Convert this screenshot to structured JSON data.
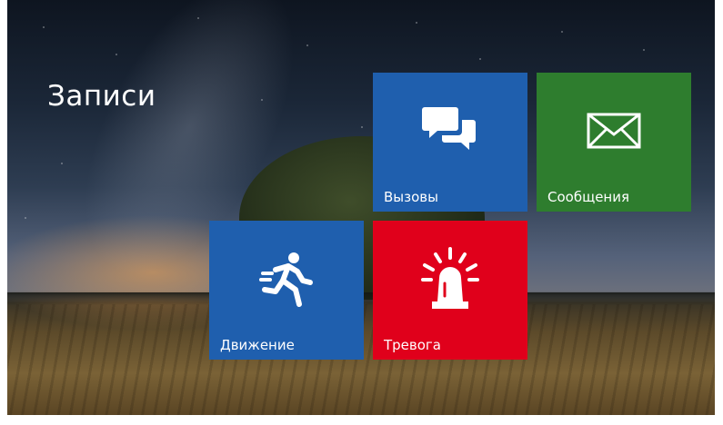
{
  "header": {
    "title": "Записи"
  },
  "tiles": [
    {
      "label": "Вызовы",
      "icon": "chat-bubbles-icon",
      "color": "#1f5fae"
    },
    {
      "label": "Сообщения",
      "icon": "envelope-icon",
      "color": "#2e7d2e"
    },
    {
      "label": "Движение",
      "icon": "running-person-icon",
      "color": "#1f5fae"
    },
    {
      "label": "Тревога",
      "icon": "alarm-siren-icon",
      "color": "#e0001b"
    }
  ]
}
